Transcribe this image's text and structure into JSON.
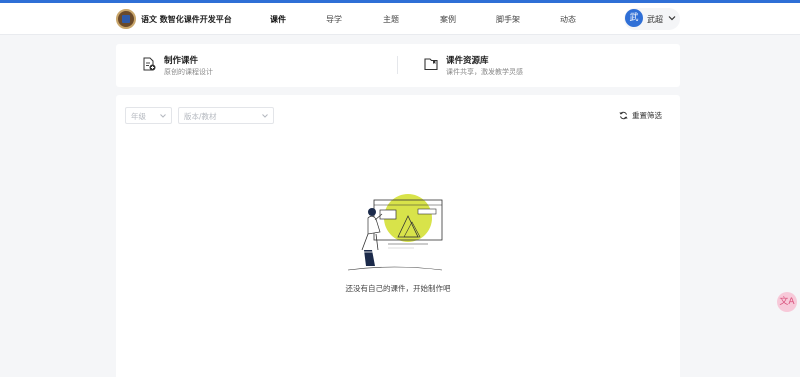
{
  "header": {
    "brand": "语文 数智化课件开发平台",
    "nav": [
      {
        "label": "课件",
        "active": true
      },
      {
        "label": "导学",
        "active": false
      },
      {
        "label": "主题",
        "active": false
      },
      {
        "label": "案例",
        "active": false
      },
      {
        "label": "脚手架",
        "active": false
      },
      {
        "label": "动态",
        "active": false
      }
    ],
    "user": {
      "avatar_text": "武",
      "name": "武超"
    }
  },
  "cards": [
    {
      "title": "制作课件",
      "subtitle": "原创的课程设计",
      "icon": "document-edit-icon"
    },
    {
      "title": "课件资源库",
      "subtitle": "课件共享，激发教学灵感",
      "icon": "folder-icon"
    }
  ],
  "filters": {
    "grade_placeholder": "年级",
    "edition_placeholder": "版本/教材",
    "reset_label": "重置筛选"
  },
  "empty": {
    "message": "还没有自己的课件，开始制作吧"
  },
  "float_button": {
    "label": "文A",
    "icon": "translate-icon"
  },
  "colors": {
    "accent": "#2f6fd6",
    "illustration_highlight": "#d8e34a"
  }
}
